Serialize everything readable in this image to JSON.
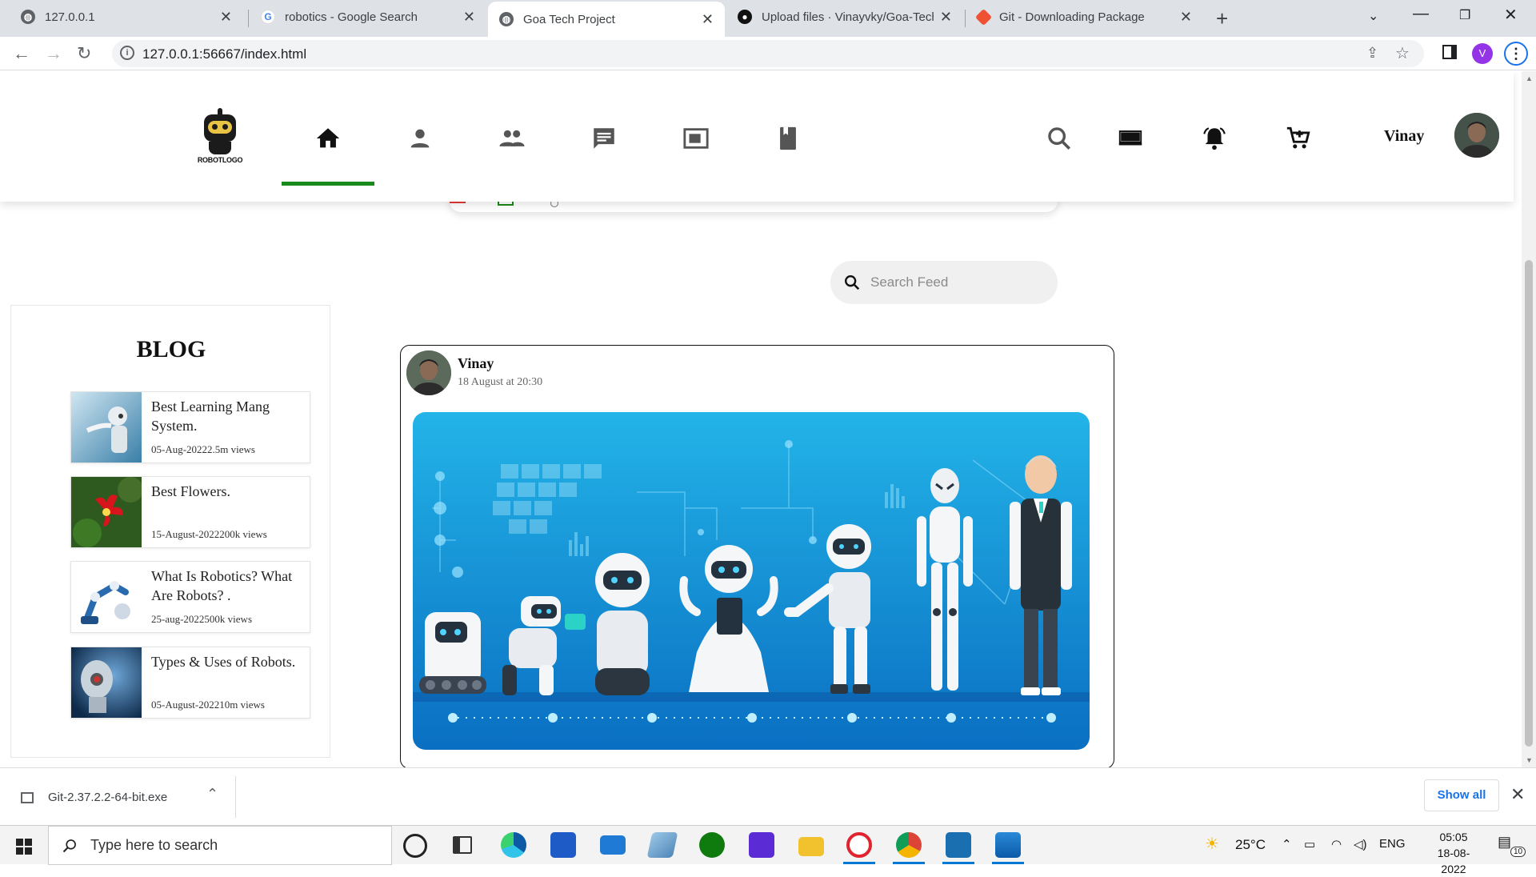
{
  "browser": {
    "tabs": [
      {
        "title": "127.0.0.1",
        "icon": "globe-icon",
        "active": false
      },
      {
        "title": "robotics - Google Search",
        "icon": "google-icon",
        "active": false
      },
      {
        "title": "Goa Tech Project",
        "icon": "globe-icon",
        "active": true
      },
      {
        "title": "Upload files · Vinayvky/Goa-Tech",
        "icon": "github-icon",
        "active": false
      },
      {
        "title": "Git - Downloading Package",
        "icon": "git-icon",
        "active": false
      }
    ],
    "url": "127.0.0.1:56667/index.html",
    "profile_initial": "V"
  },
  "site": {
    "logo_text": "ROBOTLOGO",
    "nav_icons": [
      "home-icon",
      "person-icon",
      "group-icon",
      "chat-icon",
      "screen-icon",
      "book-icon"
    ],
    "active_nav": "home-icon",
    "right_icons": [
      "search-icon",
      "keyboard-icon",
      "bell-icon",
      "cart-icon"
    ],
    "username": "Vinay",
    "accent_color": "#1a8a1a"
  },
  "search_feed": {
    "placeholder": "Search Feed"
  },
  "blog": {
    "title": "BLOG",
    "items": [
      {
        "title": "Best Learning Mang System.",
        "meta": "05-Aug-20222.5m views"
      },
      {
        "title": "Best Flowers.",
        "meta": "15-August-2022200k views"
      },
      {
        "title": "What Is Robotics? What Are Robots? .",
        "meta": "25-aug-2022500k views"
      },
      {
        "title": "Types & Uses of Robots.",
        "meta": "05-August-202210m views"
      }
    ]
  },
  "post": {
    "author": "Vinay",
    "date": "18 August at 20:30"
  },
  "downloads": {
    "file": "Git-2.37.2.2-64-bit.exe",
    "show_all": "Show all"
  },
  "taskbar": {
    "search_placeholder": "Type here to search",
    "temperature": "25°C",
    "language": "ENG",
    "time": "05:05",
    "date": "18-08-2022",
    "notifications": "10"
  }
}
